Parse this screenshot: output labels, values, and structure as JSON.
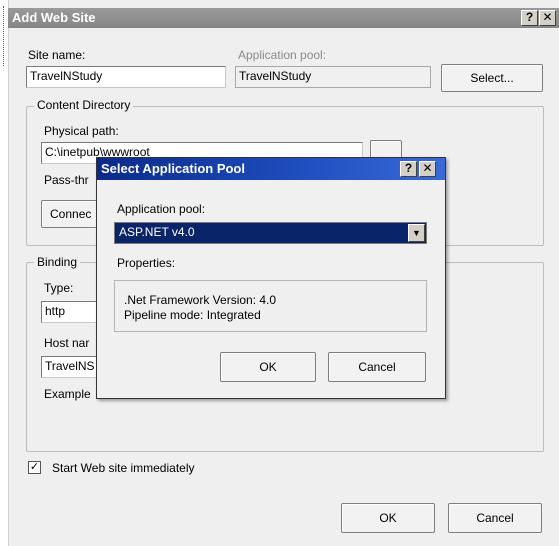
{
  "window": {
    "title": "Add Web Site",
    "help_glyph": "?",
    "close_glyph": "✕"
  },
  "site_name": {
    "label": "Site name:",
    "value": "TravelNStudy"
  },
  "app_pool": {
    "label": "Application pool:",
    "value": "TravelNStudy",
    "select_label": "Select..."
  },
  "content_directory": {
    "legend": "Content Directory",
    "physical_path_label": "Physical path:",
    "physical_path_value": "C:\\inetpub\\wwwroot",
    "pass_through_label": "Pass-thr",
    "connect_label": "Connec"
  },
  "binding": {
    "legend": "Binding",
    "type_label": "Type:",
    "type_value": "http",
    "host_label": "Host nar",
    "host_value": "TravelNS",
    "example_label": "Example"
  },
  "start_immediately": {
    "label": "Start Web site immediately",
    "checked": true,
    "check_glyph": "✓"
  },
  "footer": {
    "ok_label": "OK",
    "cancel_label": "Cancel"
  },
  "modal": {
    "title": "Select Application Pool",
    "help_glyph": "?",
    "close_glyph": "✕",
    "pool_label": "Application pool:",
    "pool_selected": "ASP.NET v4.0",
    "dropdown_glyph": "▼",
    "properties_label": "Properties:",
    "framework_line": ".Net Framework Version: 4.0",
    "pipeline_line": "Pipeline mode: Integrated",
    "ok_label": "OK",
    "cancel_label": "Cancel"
  },
  "colors": {
    "modal_title_bg": "#0a246a",
    "outer_title_bg": "#8e8e8e",
    "dialog_bg": "#efefef"
  }
}
